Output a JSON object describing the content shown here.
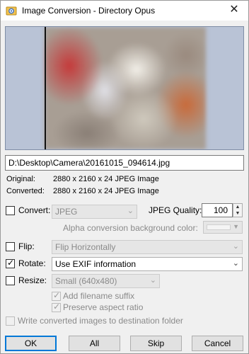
{
  "window": {
    "title": "Image Conversion - Directory Opus",
    "close_glyph": "✕"
  },
  "preview": {
    "path": "D:\\Desktop\\Camera\\20161015_094614.jpg"
  },
  "info": {
    "original_label": "Original:",
    "original_value": "2880 x 2160 x 24 JPEG Image",
    "converted_label": "Converted:",
    "converted_value": "2880 x 2160 x 24 JPEG Image"
  },
  "convert": {
    "label": "Convert:",
    "checked": false,
    "format": "JPEG",
    "quality_label": "JPEG Quality:",
    "quality_value": "100",
    "alpha_label": "Alpha conversion background color:"
  },
  "flip": {
    "label": "Flip:",
    "checked": false,
    "value": "Flip Horizontally"
  },
  "rotate": {
    "label": "Rotate:",
    "checked": true,
    "value": "Use EXIF information"
  },
  "resize": {
    "label": "Resize:",
    "checked": false,
    "value": "Small (640x480)",
    "add_suffix_label": "Add filename suffix",
    "add_suffix_checked": true,
    "preserve_aspect_label": "Preserve aspect ratio",
    "preserve_aspect_checked": true
  },
  "write_to_dest": {
    "label": "Write converted images to destination folder",
    "checked": false
  },
  "buttons": {
    "ok": "OK",
    "all": "All",
    "skip": "Skip",
    "cancel": "Cancel"
  },
  "icons": {
    "app": "directory-opus-icon",
    "dropdown": "chevron-down-icon"
  }
}
